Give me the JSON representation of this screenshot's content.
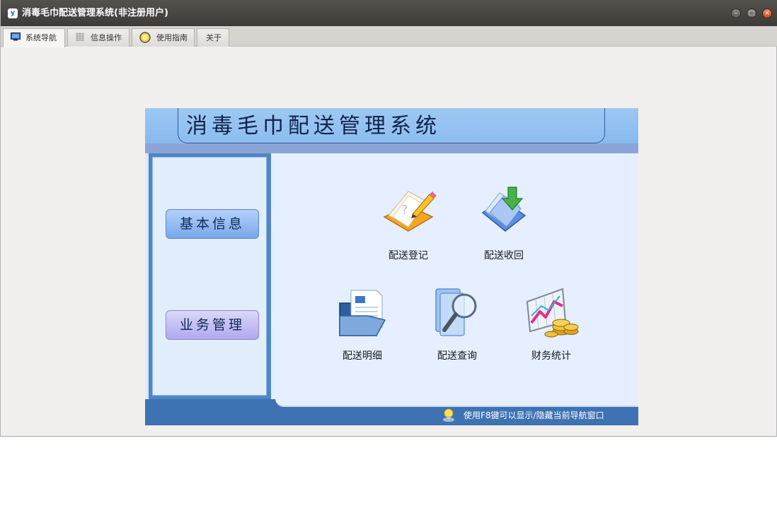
{
  "window": {
    "title": "消毒毛巾配送管理系统(非注册用户)",
    "app_icon_glyph": "y",
    "controls": [
      "minimize-icon",
      "maximize-icon",
      "close-icon"
    ],
    "control_glyphs": {
      "minimize": "–",
      "maximize": "□",
      "close": "×"
    }
  },
  "tabs": [
    {
      "label": "系统导航",
      "icon": "monitor-icon",
      "active": true
    },
    {
      "label": "信息操作",
      "icon": "grid-icon",
      "active": false
    },
    {
      "label": "使用指南",
      "icon": "help-circle-icon",
      "active": false
    },
    {
      "label": "关于",
      "icon": "",
      "active": false
    }
  ],
  "navigator": {
    "title": "消毒毛巾配送管理系统",
    "menu": [
      {
        "label": "基本信息"
      },
      {
        "label": "业务管理"
      }
    ],
    "items": [
      {
        "label": "配送登记",
        "icon": "notebook-pencil-icon"
      },
      {
        "label": "配送收回",
        "icon": "download-folder-icon"
      },
      {
        "label": "配送明细",
        "icon": "document-folder-icon"
      },
      {
        "label": "配送查询",
        "icon": "magnifier-icon"
      },
      {
        "label": "财务统计",
        "icon": "chart-coins-icon"
      }
    ],
    "hint": "使用F8键可以显示/隐藏当前导航窗口"
  },
  "colors": {
    "titlebar": "#3c3b37",
    "header": "#8cbdf0",
    "panel": "#4f86c6",
    "footer": "#3e72b2",
    "content": "#e5efff"
  }
}
